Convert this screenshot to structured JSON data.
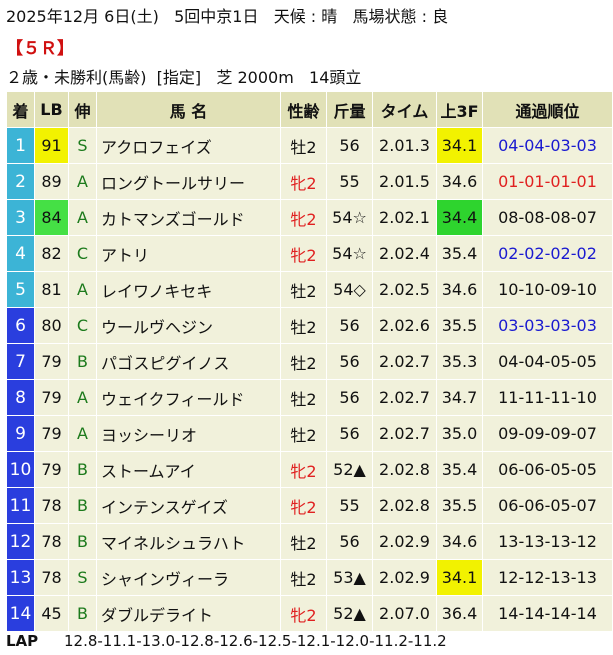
{
  "header": {
    "line1": "2025年12月 6日(土)   5回中京1日   天候 : 晴   馬場状態 : 良",
    "race": "【５Ｒ】",
    "line3": "２歳・未勝利(馬齢)  [指定]   芝 2000m   14頭立"
  },
  "columns": [
    "着",
    "LB",
    "伸",
    "馬 名",
    "性齢",
    "斤量",
    "タイム",
    "上3F",
    "通過順位"
  ],
  "colors": {
    "number_bg": "#2a3ede",
    "number_bg_top3": "#3cb4d6",
    "lb_yellow": "#f2f200",
    "lb_green": "#45e045",
    "f3_yellow": "#f2f200",
    "f3_green": "#2ed42e",
    "mare": "#e02020",
    "pass_blue": "#1a1ad0",
    "pass_red": "#e02020"
  },
  "rows": [
    {
      "pos": "1",
      "lb": "91",
      "grade": "S",
      "name": "アクロフェイズ",
      "sexage": "牡2",
      "weight": "56",
      "time": "2.01.3",
      "f3": "34.1",
      "passing": "04-04-03-03",
      "lb_hl": "yellow",
      "f3_hl": "yellow",
      "sex_color": "",
      "pass_color": "blue"
    },
    {
      "pos": "2",
      "lb": "89",
      "grade": "A",
      "name": "ロングトールサリー",
      "sexage": "牝2",
      "weight": "55",
      "time": "2.01.5",
      "f3": "34.6",
      "passing": "01-01-01-01",
      "lb_hl": "",
      "f3_hl": "",
      "sex_color": "red",
      "pass_color": "red"
    },
    {
      "pos": "3",
      "lb": "84",
      "grade": "A",
      "name": "カトマンズゴールド",
      "sexage": "牝2",
      "weight": "54☆",
      "time": "2.02.1",
      "f3": "34.4",
      "passing": "08-08-08-07",
      "lb_hl": "green",
      "f3_hl": "green",
      "sex_color": "red",
      "pass_color": ""
    },
    {
      "pos": "4",
      "lb": "82",
      "grade": "C",
      "name": "アトリ",
      "sexage": "牝2",
      "weight": "54☆",
      "time": "2.02.4",
      "f3": "35.4",
      "passing": "02-02-02-02",
      "lb_hl": "",
      "f3_hl": "",
      "sex_color": "red",
      "pass_color": "blue"
    },
    {
      "pos": "5",
      "lb": "81",
      "grade": "A",
      "name": "レイワノキセキ",
      "sexage": "牡2",
      "weight": "54◇",
      "time": "2.02.5",
      "f3": "34.6",
      "passing": "10-10-09-10",
      "lb_hl": "",
      "f3_hl": "",
      "sex_color": "",
      "pass_color": ""
    },
    {
      "pos": "6",
      "lb": "80",
      "grade": "C",
      "name": "ウールヴヘジン",
      "sexage": "牡2",
      "weight": "56",
      "time": "2.02.6",
      "f3": "35.5",
      "passing": "03-03-03-03",
      "lb_hl": "",
      "f3_hl": "",
      "sex_color": "",
      "pass_color": "blue"
    },
    {
      "pos": "7",
      "lb": "79",
      "grade": "B",
      "name": "パゴスピグイノス",
      "sexage": "牡2",
      "weight": "56",
      "time": "2.02.7",
      "f3": "35.3",
      "passing": "04-04-05-05",
      "lb_hl": "",
      "f3_hl": "",
      "sex_color": "",
      "pass_color": ""
    },
    {
      "pos": "8",
      "lb": "79",
      "grade": "A",
      "name": "ウェイクフィールド",
      "sexage": "牡2",
      "weight": "56",
      "time": "2.02.7",
      "f3": "34.7",
      "passing": "11-11-11-10",
      "lb_hl": "",
      "f3_hl": "",
      "sex_color": "",
      "pass_color": ""
    },
    {
      "pos": "9",
      "lb": "79",
      "grade": "A",
      "name": "ヨッシーリオ",
      "sexage": "牡2",
      "weight": "56",
      "time": "2.02.7",
      "f3": "35.0",
      "passing": "09-09-09-07",
      "lb_hl": "",
      "f3_hl": "",
      "sex_color": "",
      "pass_color": ""
    },
    {
      "pos": "10",
      "lb": "79",
      "grade": "B",
      "name": "ストームアイ",
      "sexage": "牝2",
      "weight": "52▲",
      "time": "2.02.8",
      "f3": "35.4",
      "passing": "06-06-05-05",
      "lb_hl": "",
      "f3_hl": "",
      "sex_color": "red",
      "pass_color": ""
    },
    {
      "pos": "11",
      "lb": "78",
      "grade": "B",
      "name": "インテンスゲイズ",
      "sexage": "牝2",
      "weight": "55",
      "time": "2.02.8",
      "f3": "35.5",
      "passing": "06-06-05-07",
      "lb_hl": "",
      "f3_hl": "",
      "sex_color": "red",
      "pass_color": ""
    },
    {
      "pos": "12",
      "lb": "78",
      "grade": "B",
      "name": "マイネルシュラハト",
      "sexage": "牡2",
      "weight": "56",
      "time": "2.02.9",
      "f3": "34.6",
      "passing": "13-13-13-12",
      "lb_hl": "",
      "f3_hl": "",
      "sex_color": "",
      "pass_color": ""
    },
    {
      "pos": "13",
      "lb": "78",
      "grade": "S",
      "name": "シャインヴィーラ",
      "sexage": "牡2",
      "weight": "53▲",
      "time": "2.02.9",
      "f3": "34.1",
      "passing": "12-12-13-13",
      "lb_hl": "",
      "f3_hl": "yellow",
      "sex_color": "",
      "pass_color": ""
    },
    {
      "pos": "14",
      "lb": "45",
      "grade": "B",
      "name": "ダブルデライト",
      "sexage": "牝2",
      "weight": "52▲",
      "time": "2.07.0",
      "f3": "36.4",
      "passing": "14-14-14-14",
      "lb_hl": "",
      "f3_hl": "",
      "sex_color": "red",
      "pass_color": ""
    }
  ],
  "footer": {
    "lap_label": "LAP",
    "laps": "12.8-11.1-13.0-12.8-12.6-12.5-12.1-12.0-11.2-11.2"
  }
}
